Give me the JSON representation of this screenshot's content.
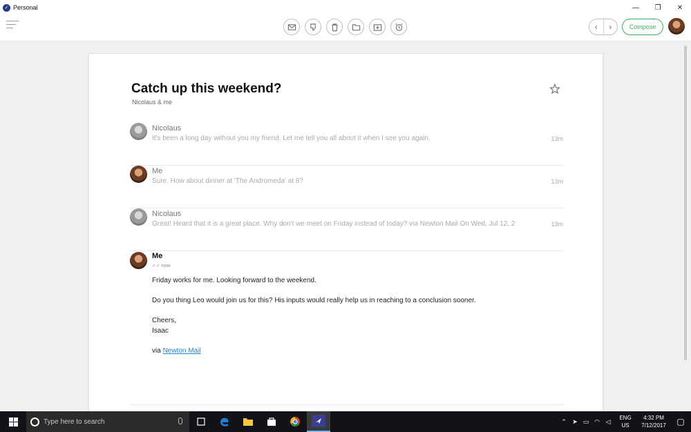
{
  "window": {
    "title": "Personal",
    "minimize": "—",
    "restore": "❐",
    "close": "✕"
  },
  "toolbar": {
    "icons": [
      "mail-icon",
      "thumb-down-icon",
      "trash-icon",
      "folder-icon",
      "archive-icon",
      "snooze-icon"
    ],
    "prev": "‹",
    "next": "›",
    "compose_label": "Compose"
  },
  "thread": {
    "subject": "Catch up this weekend?",
    "participants": "Nicolaus & me",
    "messages": [
      {
        "sender": "Nicolaus",
        "preview": "It's been a long day without you my friend. Let me tell you all about it when I see you again.",
        "time": "13m"
      },
      {
        "sender": "Me",
        "preview": "Sure. How about dinner at 'The Andromeda' at 8?",
        "time": "13m"
      },
      {
        "sender": "Nicolaus",
        "preview": "Great! Heard that it is a great place. Why don't we meet on Friday instead of today? via Newton Mail On Wed, Jul 12, 2",
        "time": "13m"
      }
    ],
    "open_message": {
      "sender": "Me",
      "status": "now",
      "line1": "Friday works for me. Looking forward to the weekend.",
      "line2": "Do you thing Leo would join us for this? His inputs would really help us in reaching to a conclusion sooner.",
      "line3": "Cheers,",
      "line4": "Isaac",
      "via_prefix": "via ",
      "via_link": "Newton Mail"
    }
  },
  "taskbar": {
    "search_placeholder": "Type here to search",
    "lang_top": "ENG",
    "lang_bottom": "US",
    "time": "4:32 PM",
    "date": "7/12/2017"
  },
  "colors": {
    "accent": "#3cae5c",
    "link": "#1a8bd6",
    "taskbar": "#111318"
  }
}
